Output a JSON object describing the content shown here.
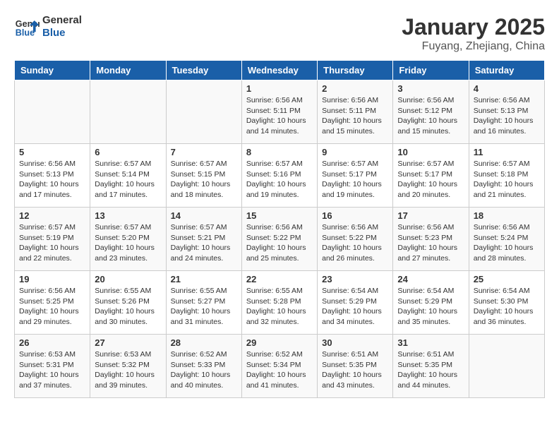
{
  "header": {
    "logo_line1": "General",
    "logo_line2": "Blue",
    "title": "January 2025",
    "subtitle": "Fuyang, Zhejiang, China"
  },
  "days_of_week": [
    "Sunday",
    "Monday",
    "Tuesday",
    "Wednesday",
    "Thursday",
    "Friday",
    "Saturday"
  ],
  "weeks": [
    [
      {
        "day": "",
        "content": ""
      },
      {
        "day": "",
        "content": ""
      },
      {
        "day": "",
        "content": ""
      },
      {
        "day": "1",
        "content": "Sunrise: 6:56 AM\nSunset: 5:11 PM\nDaylight: 10 hours and 14 minutes."
      },
      {
        "day": "2",
        "content": "Sunrise: 6:56 AM\nSunset: 5:11 PM\nDaylight: 10 hours and 15 minutes."
      },
      {
        "day": "3",
        "content": "Sunrise: 6:56 AM\nSunset: 5:12 PM\nDaylight: 10 hours and 15 minutes."
      },
      {
        "day": "4",
        "content": "Sunrise: 6:56 AM\nSunset: 5:13 PM\nDaylight: 10 hours and 16 minutes."
      }
    ],
    [
      {
        "day": "5",
        "content": "Sunrise: 6:56 AM\nSunset: 5:13 PM\nDaylight: 10 hours and 17 minutes."
      },
      {
        "day": "6",
        "content": "Sunrise: 6:57 AM\nSunset: 5:14 PM\nDaylight: 10 hours and 17 minutes."
      },
      {
        "day": "7",
        "content": "Sunrise: 6:57 AM\nSunset: 5:15 PM\nDaylight: 10 hours and 18 minutes."
      },
      {
        "day": "8",
        "content": "Sunrise: 6:57 AM\nSunset: 5:16 PM\nDaylight: 10 hours and 19 minutes."
      },
      {
        "day": "9",
        "content": "Sunrise: 6:57 AM\nSunset: 5:17 PM\nDaylight: 10 hours and 19 minutes."
      },
      {
        "day": "10",
        "content": "Sunrise: 6:57 AM\nSunset: 5:17 PM\nDaylight: 10 hours and 20 minutes."
      },
      {
        "day": "11",
        "content": "Sunrise: 6:57 AM\nSunset: 5:18 PM\nDaylight: 10 hours and 21 minutes."
      }
    ],
    [
      {
        "day": "12",
        "content": "Sunrise: 6:57 AM\nSunset: 5:19 PM\nDaylight: 10 hours and 22 minutes."
      },
      {
        "day": "13",
        "content": "Sunrise: 6:57 AM\nSunset: 5:20 PM\nDaylight: 10 hours and 23 minutes."
      },
      {
        "day": "14",
        "content": "Sunrise: 6:57 AM\nSunset: 5:21 PM\nDaylight: 10 hours and 24 minutes."
      },
      {
        "day": "15",
        "content": "Sunrise: 6:56 AM\nSunset: 5:22 PM\nDaylight: 10 hours and 25 minutes."
      },
      {
        "day": "16",
        "content": "Sunrise: 6:56 AM\nSunset: 5:22 PM\nDaylight: 10 hours and 26 minutes."
      },
      {
        "day": "17",
        "content": "Sunrise: 6:56 AM\nSunset: 5:23 PM\nDaylight: 10 hours and 27 minutes."
      },
      {
        "day": "18",
        "content": "Sunrise: 6:56 AM\nSunset: 5:24 PM\nDaylight: 10 hours and 28 minutes."
      }
    ],
    [
      {
        "day": "19",
        "content": "Sunrise: 6:56 AM\nSunset: 5:25 PM\nDaylight: 10 hours and 29 minutes."
      },
      {
        "day": "20",
        "content": "Sunrise: 6:55 AM\nSunset: 5:26 PM\nDaylight: 10 hours and 30 minutes."
      },
      {
        "day": "21",
        "content": "Sunrise: 6:55 AM\nSunset: 5:27 PM\nDaylight: 10 hours and 31 minutes."
      },
      {
        "day": "22",
        "content": "Sunrise: 6:55 AM\nSunset: 5:28 PM\nDaylight: 10 hours and 32 minutes."
      },
      {
        "day": "23",
        "content": "Sunrise: 6:54 AM\nSunset: 5:29 PM\nDaylight: 10 hours and 34 minutes."
      },
      {
        "day": "24",
        "content": "Sunrise: 6:54 AM\nSunset: 5:29 PM\nDaylight: 10 hours and 35 minutes."
      },
      {
        "day": "25",
        "content": "Sunrise: 6:54 AM\nSunset: 5:30 PM\nDaylight: 10 hours and 36 minutes."
      }
    ],
    [
      {
        "day": "26",
        "content": "Sunrise: 6:53 AM\nSunset: 5:31 PM\nDaylight: 10 hours and 37 minutes."
      },
      {
        "day": "27",
        "content": "Sunrise: 6:53 AM\nSunset: 5:32 PM\nDaylight: 10 hours and 39 minutes."
      },
      {
        "day": "28",
        "content": "Sunrise: 6:52 AM\nSunset: 5:33 PM\nDaylight: 10 hours and 40 minutes."
      },
      {
        "day": "29",
        "content": "Sunrise: 6:52 AM\nSunset: 5:34 PM\nDaylight: 10 hours and 41 minutes."
      },
      {
        "day": "30",
        "content": "Sunrise: 6:51 AM\nSunset: 5:35 PM\nDaylight: 10 hours and 43 minutes."
      },
      {
        "day": "31",
        "content": "Sunrise: 6:51 AM\nSunset: 5:35 PM\nDaylight: 10 hours and 44 minutes."
      },
      {
        "day": "",
        "content": ""
      }
    ]
  ]
}
